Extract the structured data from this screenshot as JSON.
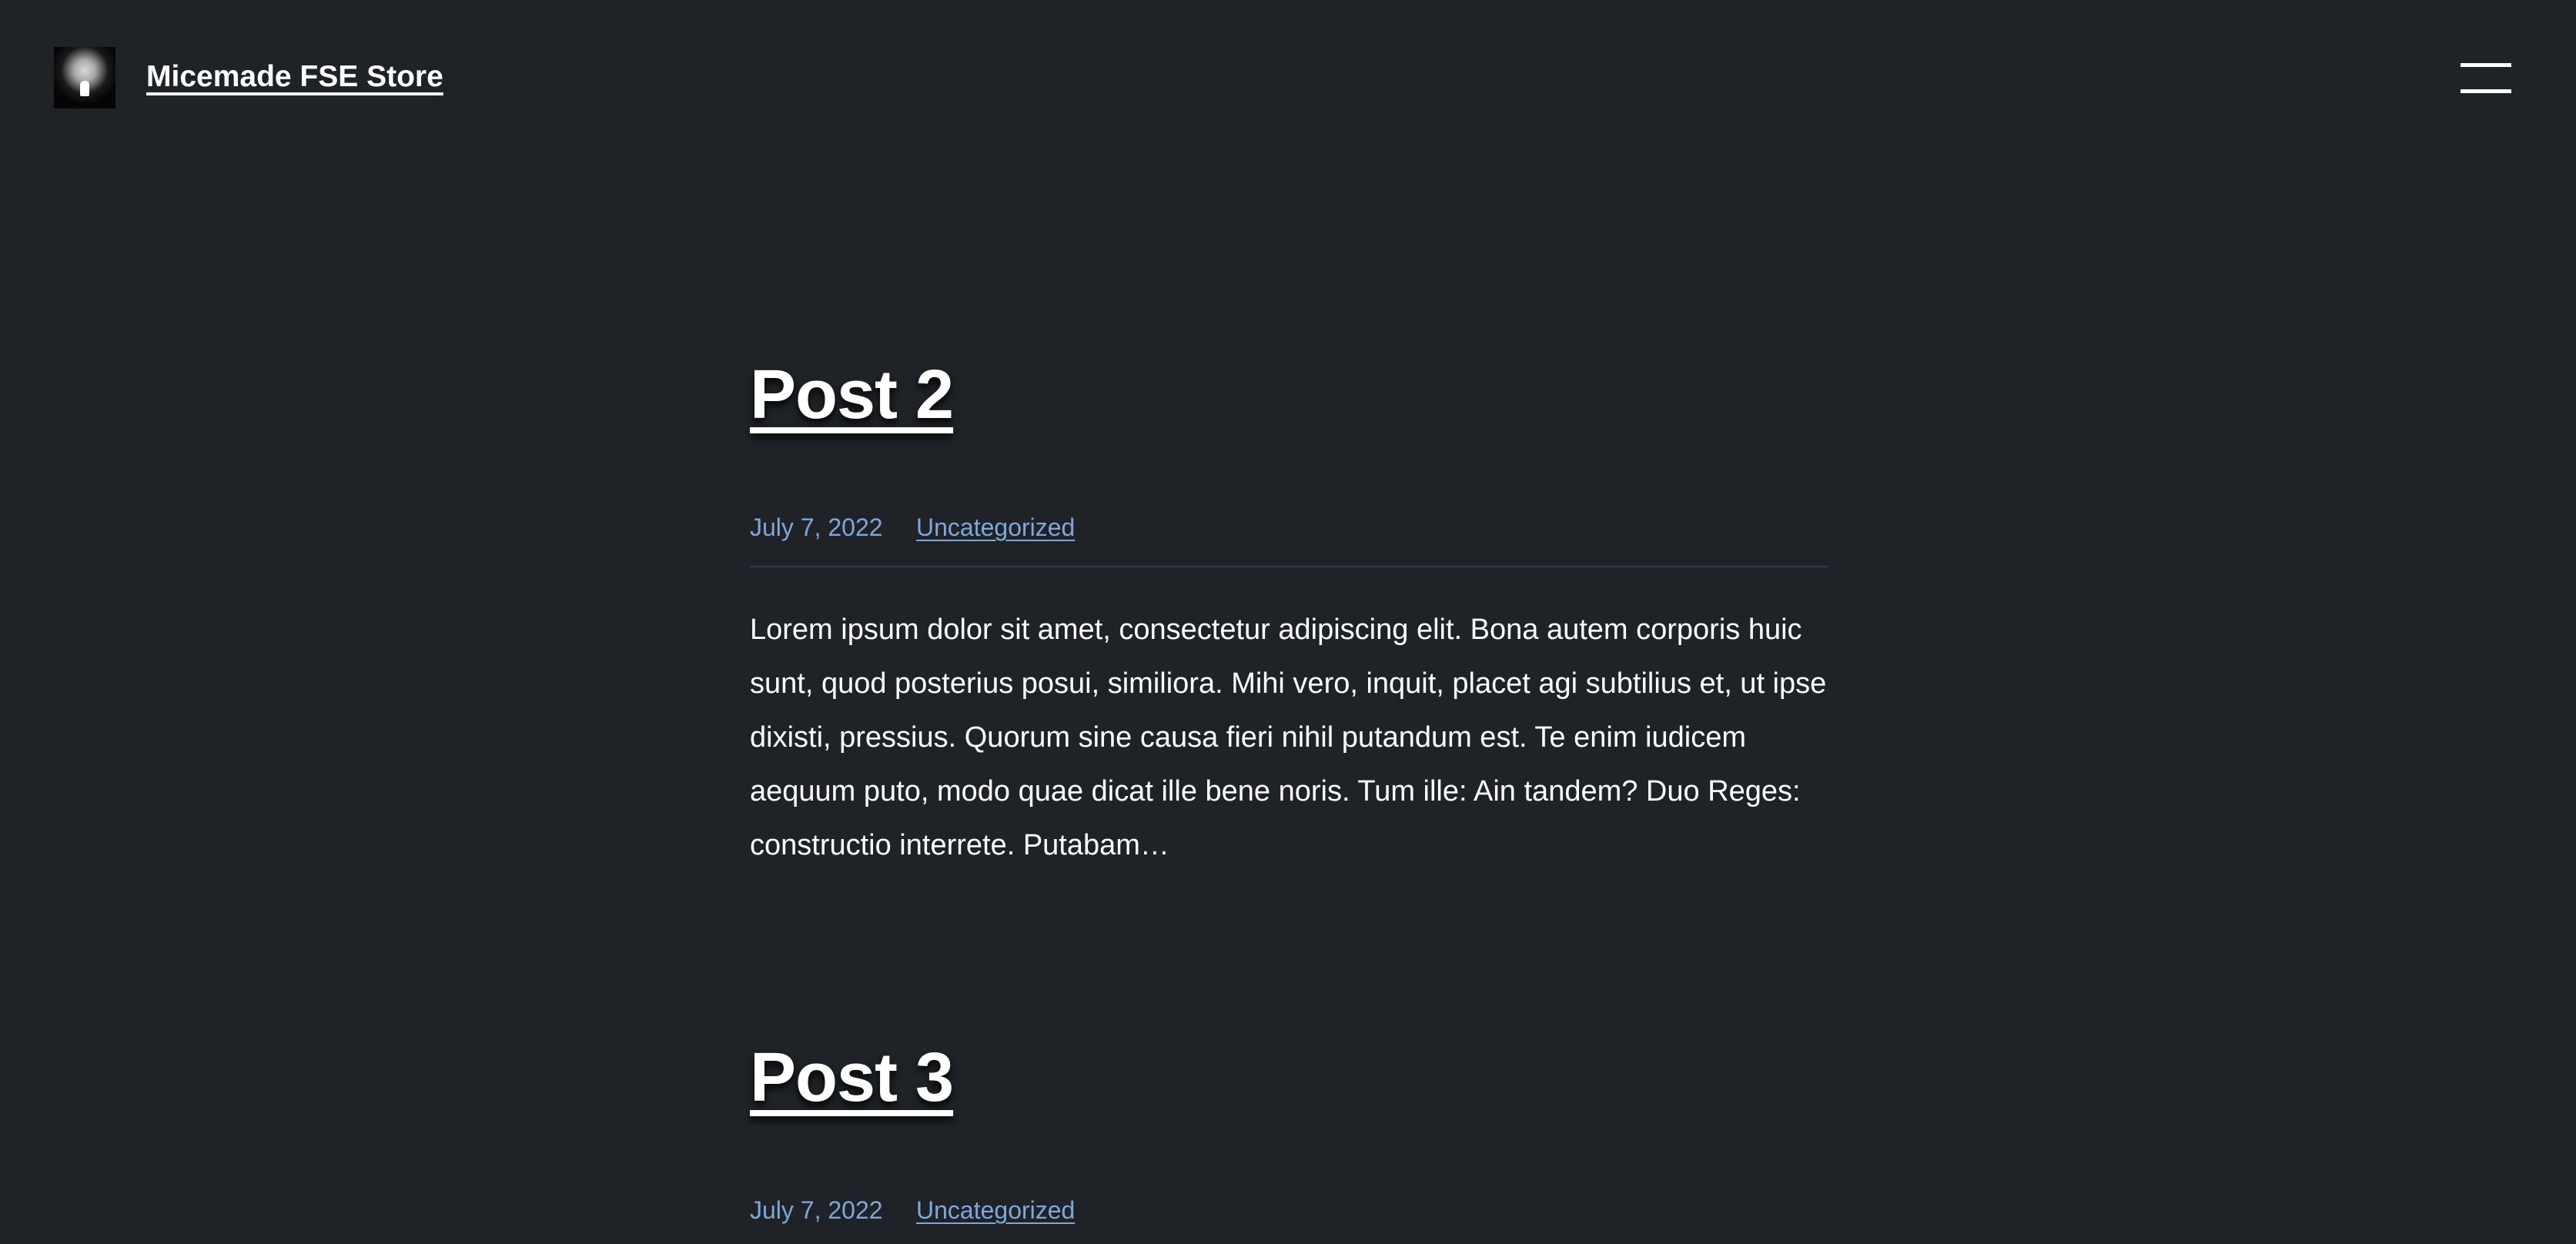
{
  "site": {
    "title": "Micemade FSE Store",
    "logo_icon": "site-logo-icon",
    "menu_icon": "hamburger-menu-icon"
  },
  "posts": [
    {
      "title": "Post 2",
      "date": "July 7, 2022",
      "category": "Uncategorized",
      "excerpt": "Lorem ipsum dolor sit amet, consectetur adipiscing elit. Bona autem corporis huic sunt, quod posterius posui, similiora. Mihi vero, inquit, placet agi subtilius et, ut ipse dixisti, pressius. Quorum sine causa fieri nihil putandum est. Te enim iudicem aequum puto, modo quae dicat ille bene noris. Tum ille: Ain tandem? Duo Reges: constructio interrete. Putabam…"
    },
    {
      "title": "Post 3",
      "date": "July 7, 2022",
      "category": "Uncategorized"
    }
  ],
  "colors": {
    "background": "#1f2328",
    "text": "#ffffff",
    "meta_link": "#7fa8d9",
    "divider": "#2e3d4c"
  }
}
